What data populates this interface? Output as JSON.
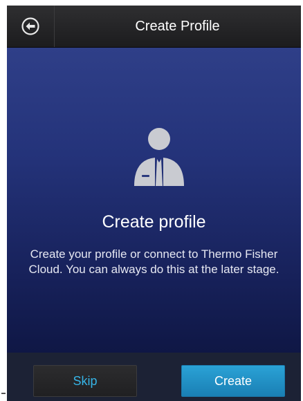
{
  "header": {
    "title": "Create Profile",
    "back_icon": "arrow-left-circle-icon"
  },
  "main": {
    "icon": "user-profile-icon",
    "title": "Create profile",
    "description": "Create your profile or connect to Thermo Fisher Cloud. You can always do this at the later stage."
  },
  "footer": {
    "skip_label": "Skip",
    "create_label": "Create"
  },
  "colors": {
    "accent_blue": "#1a8fcc",
    "skip_text": "#36b4e6"
  }
}
